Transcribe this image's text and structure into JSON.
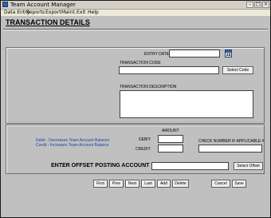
{
  "window": {
    "title": "Team Account Manager"
  },
  "menu": [
    "Data Entry",
    "Reports",
    "Export",
    "Maint.",
    "Exit",
    "Help"
  ],
  "page": {
    "title": "TRANSACTION DETAILS"
  },
  "form": {
    "entry_date_label": "ENTRY DATE:",
    "calendar_day": "24",
    "transaction_code_label": "TRANSACTION CODE",
    "select_code_label": "Select Code",
    "transaction_description_label": "TRANSACTION DESCRIPTION"
  },
  "amount": {
    "header": "AMOUNT",
    "debit_label": "DEBIT:",
    "credit_label": "CREDIT:",
    "debit_hint": "Debit - Decreases Team Account Balance",
    "credit_hint": "Credit - Increases  Team Account Balance",
    "check_number_label": "CHECK NUMBER IF APPLICABLE #"
  },
  "offset": {
    "label": "ENTER OFFSET POSTING ACCOUNT",
    "select_label": "Select Offset"
  },
  "nav_buttons": [
    "First",
    "Prev",
    "Next",
    "Last",
    "Add",
    "Delete"
  ],
  "action_buttons": [
    "Cancel",
    "Save"
  ],
  "colors": {
    "window_bg": "#c0c0c0",
    "hint_text": "#1f3fa8",
    "field_bg": "#ffffff"
  }
}
